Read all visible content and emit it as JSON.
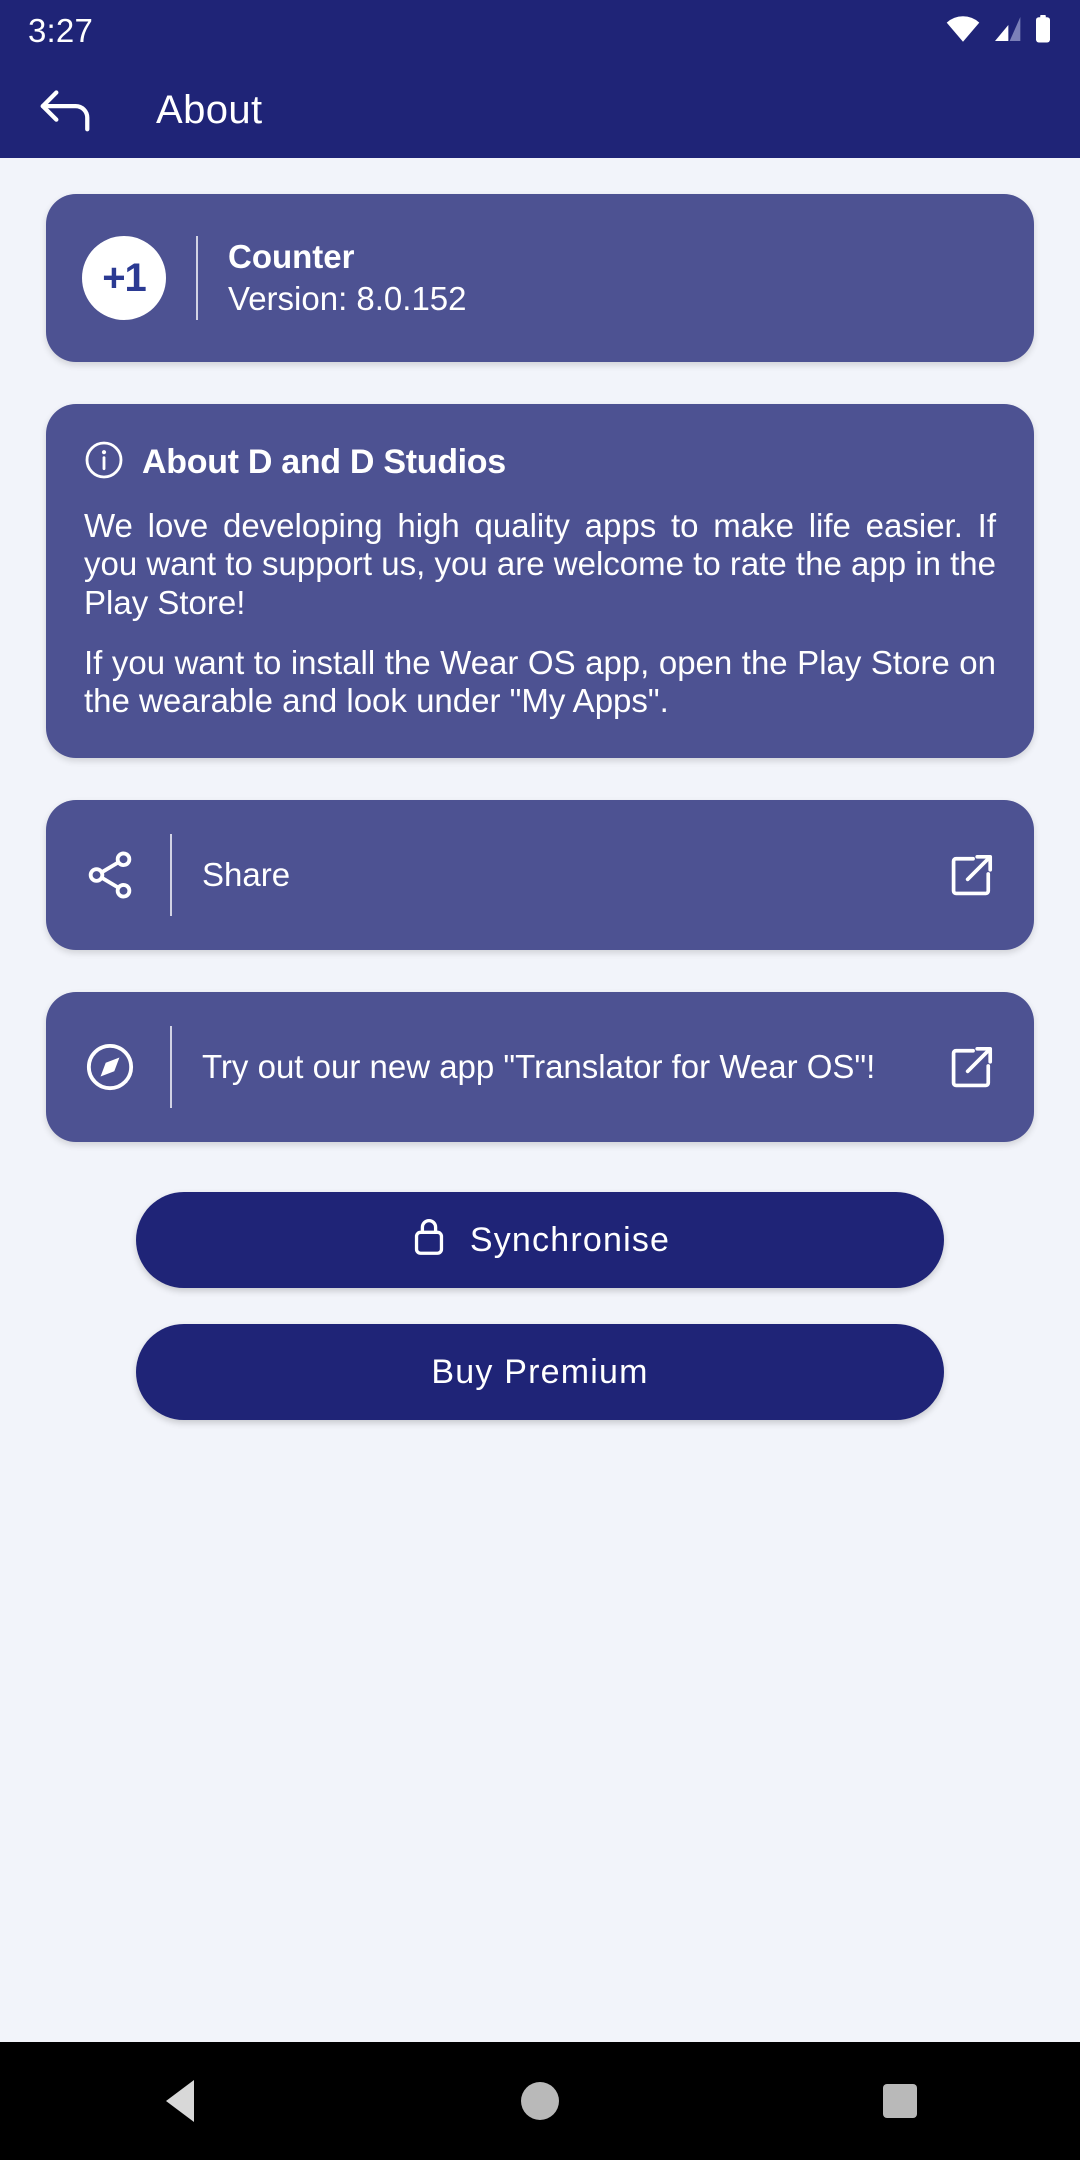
{
  "status_bar": {
    "time": "3:27",
    "icons": [
      "wifi-icon",
      "cellular-signal-icon",
      "battery-icon"
    ]
  },
  "app_bar": {
    "back_icon": "back-arrow-icon",
    "title": "About"
  },
  "app_info_card": {
    "icon_label": "+1",
    "name": "Counter",
    "version": "Version:  8.0.152"
  },
  "about_card": {
    "icon": "info-circle-icon",
    "title": "About D and D Studios",
    "paragraph_1": "We love developing high quality apps to make life easier. If you want to support us, you are welcome to rate the app in the Play Store!",
    "paragraph_2": "If you want to install the Wear OS app, open the Play Store on the wearable and look under \"My Apps\"."
  },
  "share_row": {
    "icon": "share-icon",
    "label": "Share",
    "action_icon": "external-link-icon"
  },
  "promo_row": {
    "icon": "compass-icon",
    "label": "Try out our new app \"Translator for Wear OS\"!",
    "action_icon": "external-link-icon"
  },
  "buttons": {
    "synchronise": {
      "label": "Synchronise",
      "icon": "lock-icon"
    },
    "buy_premium": {
      "label": "Buy Premium"
    }
  },
  "nav_bar": {
    "back": "nav-back-icon",
    "home": "nav-home-icon",
    "recents": "nav-recents-icon"
  },
  "colors": {
    "primary": "#1f2477",
    "card": "#4d5292",
    "background": "#f2f4fa",
    "on_primary": "#ffffff"
  }
}
